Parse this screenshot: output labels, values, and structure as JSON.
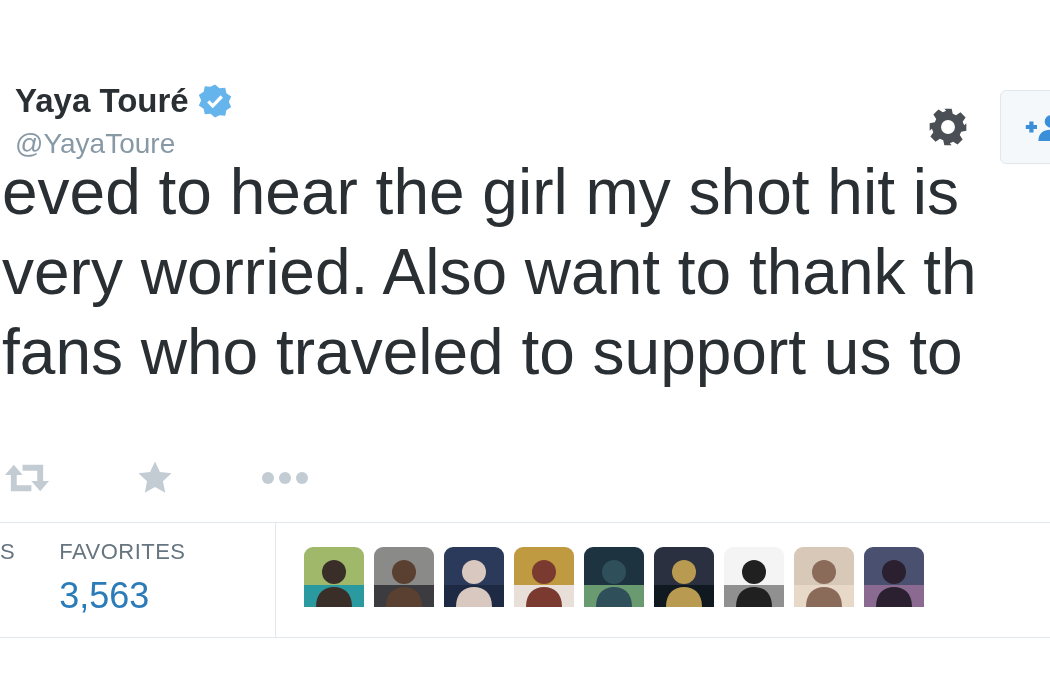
{
  "author": {
    "name": "Yaya Touré",
    "verified": true,
    "handle": "@YayaToure"
  },
  "header_actions": [
    {
      "kind": "settings"
    },
    {
      "kind": "follow"
    }
  ],
  "tweet_lines": [
    "eved to hear the girl my shot hit is",
    "very worried. Also want to thank th",
    "fans who traveled to support us to"
  ],
  "actions": [
    {
      "kind": "retweet"
    },
    {
      "kind": "favorite"
    },
    {
      "kind": "more"
    }
  ],
  "stats": [
    {
      "label": "S"
    },
    {
      "label": "FAVORITES",
      "value": "3,563"
    }
  ]
}
